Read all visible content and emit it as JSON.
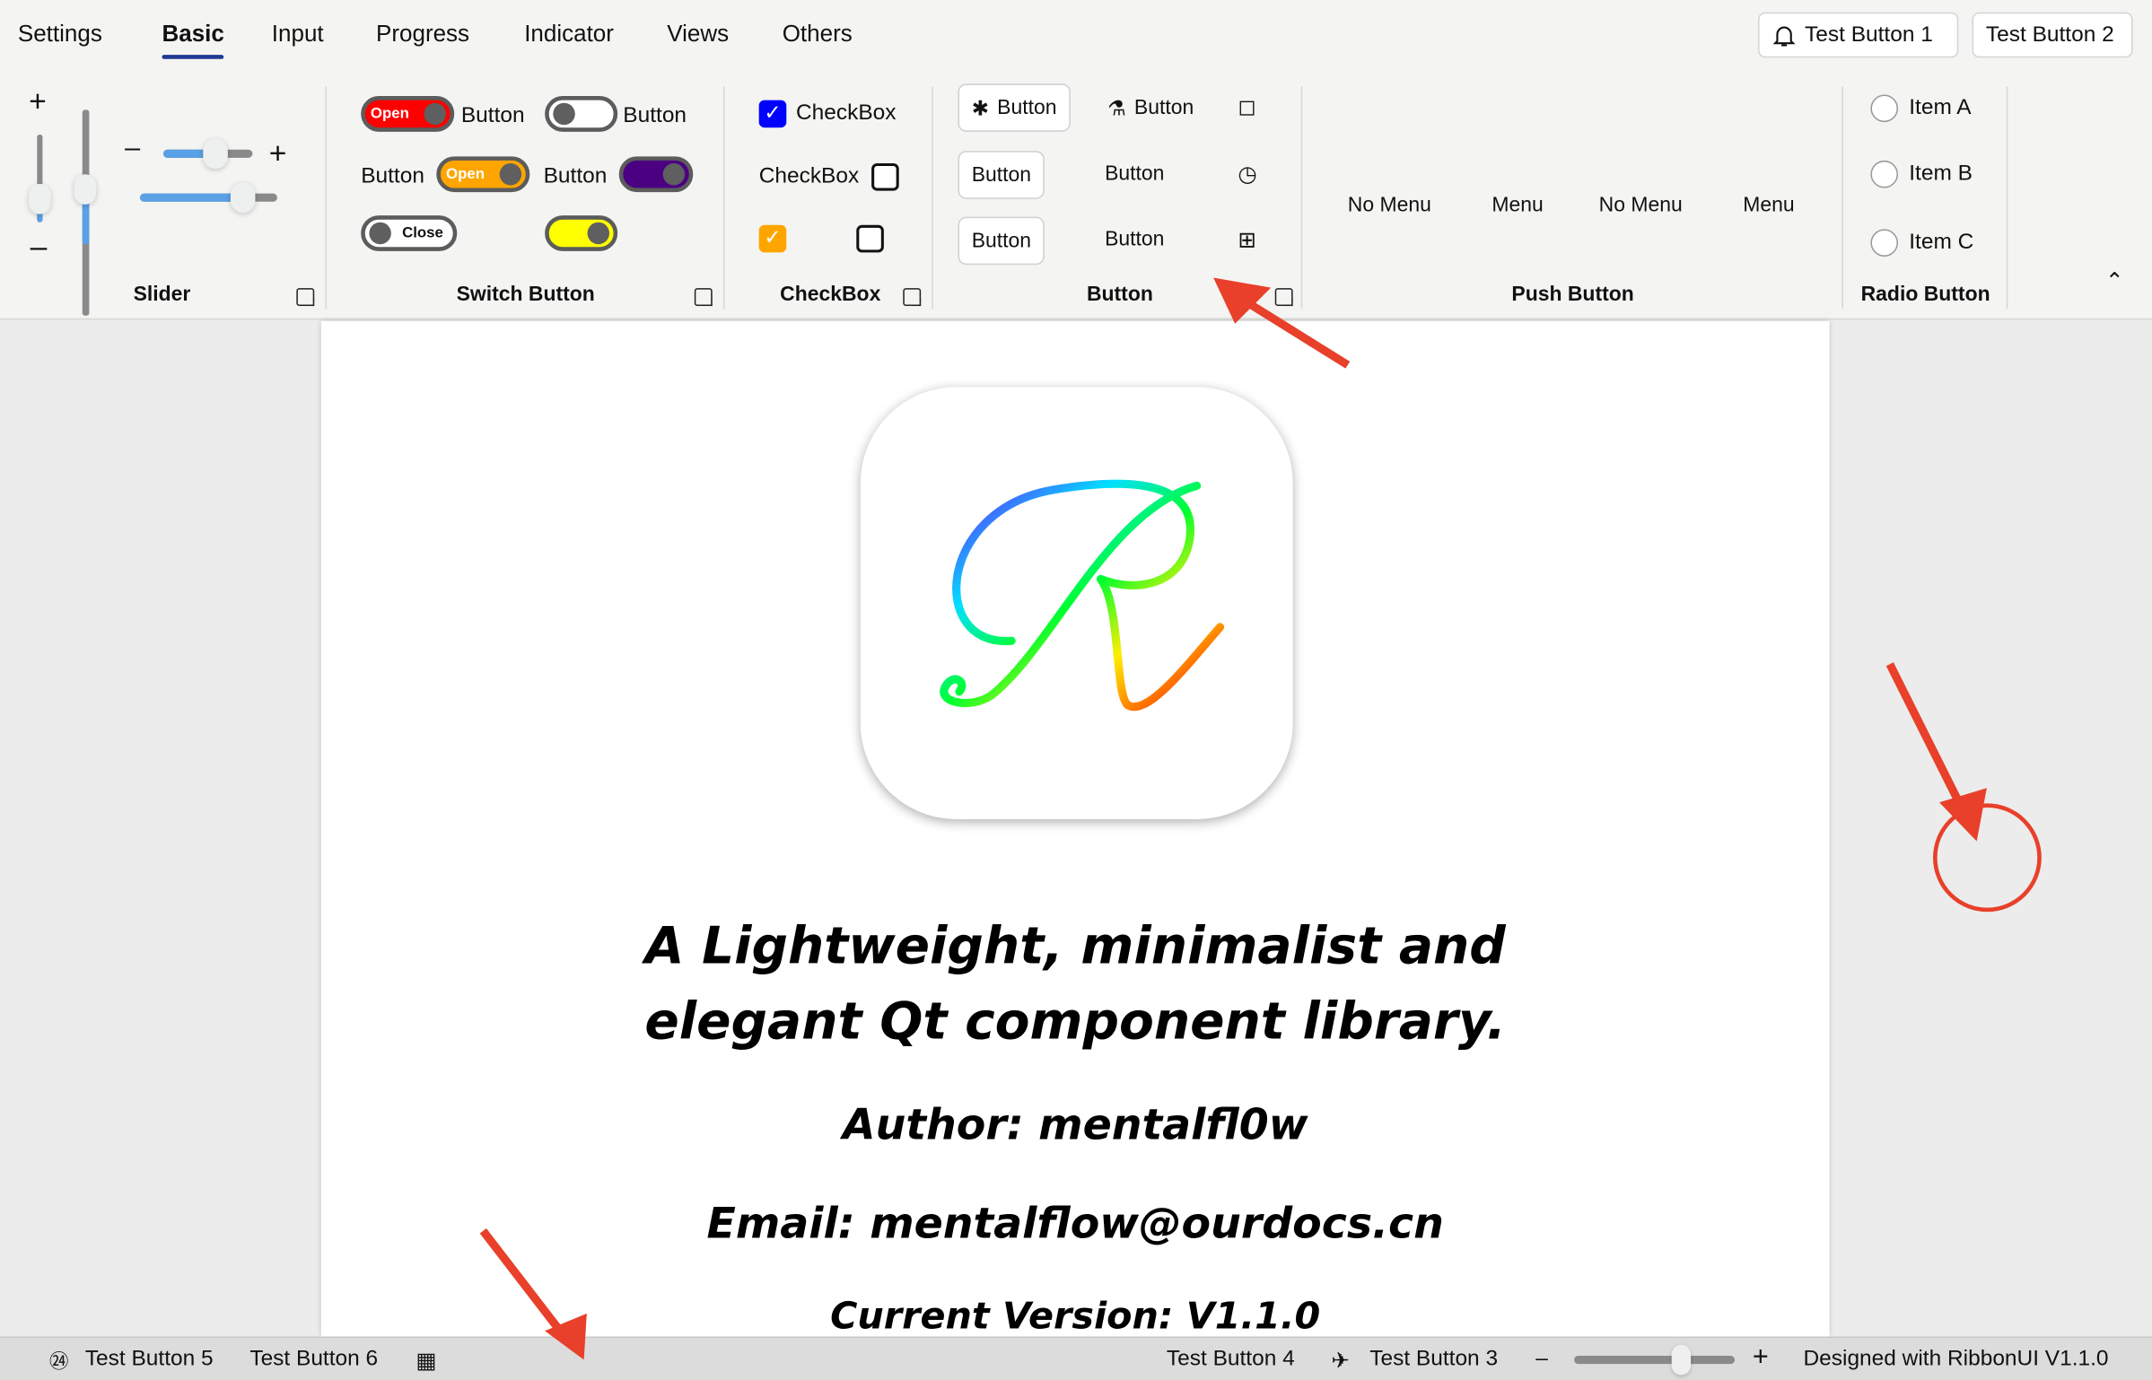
{
  "tabs": [
    "Settings",
    "Basic",
    "Input",
    "Progress",
    "Indicator",
    "Views",
    "Others"
  ],
  "active_tab": "Basic",
  "top_buttons": {
    "b1": "Test Button 1",
    "b2": "Test Button 2"
  },
  "groups": {
    "slider": {
      "label": "Slider",
      "values": {
        "v1": 0.3,
        "v2": 0.45,
        "h1": 0.6,
        "h2": 0.75
      }
    },
    "switch": {
      "label": "Switch Button",
      "open": "Open",
      "close": "Close",
      "button": "Button"
    },
    "checkbox": {
      "label": "CheckBox",
      "item": "CheckBox"
    },
    "button": {
      "label": "Button",
      "item": "Button"
    },
    "push": {
      "label": "Push Button",
      "items": [
        "No Menu",
        "Menu",
        "No Menu",
        "Menu"
      ]
    },
    "radio": {
      "label": "Radio Button",
      "items": [
        "Item A",
        "Item B",
        "Item C"
      ]
    }
  },
  "content": {
    "line1": "A Lightweight, minimalist and",
    "line2": "elegant Qt component library.",
    "author": "Author: mentalfl0w",
    "email": "Email: mentalflow@ourdocs.cn",
    "version": "Current Version: V1.1.0"
  },
  "status": {
    "b5": "Test Button 5",
    "b6": "Test Button 6",
    "b4": "Test Button 4",
    "b3": "Test Button 3",
    "zoom": 0.68,
    "credit": "Designed with RibbonUI V1.1.0"
  },
  "colors": {
    "accent": "#1f3a93",
    "slider": "#5aa0e6",
    "annotation": "#e8402a"
  }
}
